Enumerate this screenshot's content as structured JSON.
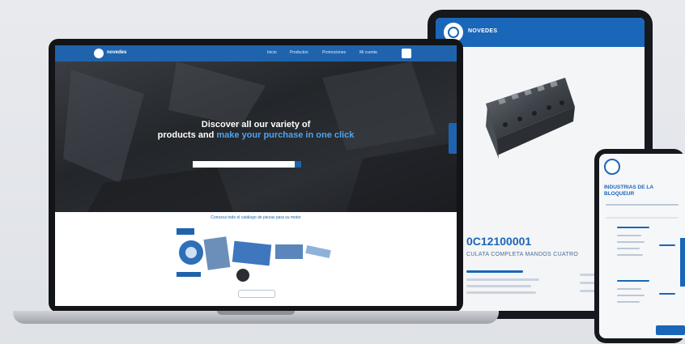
{
  "tablet": {
    "brand": "NOVEDES",
    "product_code": "0C12100001",
    "product_desc": "CULATA COMPLETA MANDOS CUATRO"
  },
  "laptop": {
    "brand": "novedes",
    "nav": [
      "Inicio",
      "Productos",
      "Promociones",
      "Mi cuenta"
    ],
    "hero_line1": "Discover all our variety of",
    "hero_line2_plain": "products and ",
    "hero_line2_highlight": "make your purchase in one click",
    "promo_title": "Conozca todo el catálogo de piezas para su motor",
    "search_placeholder": ""
  },
  "phone": {
    "title": "INDUSTRIAS DE LA BLOQUEUR"
  },
  "colors": {
    "brand_blue": "#1f63ad",
    "highlight_blue": "#4ea3f0"
  }
}
